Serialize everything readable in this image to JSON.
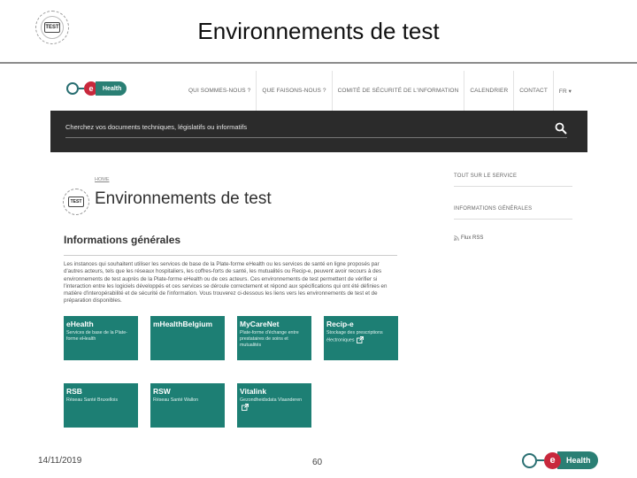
{
  "slide": {
    "title": "Environnements de test",
    "logo_text": "TEST",
    "date": "14/11/2019",
    "page_number": "60",
    "footer_logo": {
      "e": "e",
      "word": "Health"
    }
  },
  "site": {
    "brand": {
      "e": "e",
      "word": "Health"
    },
    "nav": [
      "QUI SOMMES-NOUS ?",
      "QUE FAISONS-NOUS ?",
      "COMITÉ DE SÉCURITÉ DE L'INFORMATION",
      "CALENDRIER",
      "CONTACT",
      "FR ▾"
    ],
    "search": {
      "placeholder": "Cherchez vos documents techniques, législatifs ou informatifs"
    },
    "breadcrumb": "HOME",
    "page_logo_text": "TEST",
    "page_title": "Environnements de test",
    "section_title": "Informations générales",
    "intro": "Les instances qui souhaitent utiliser les services de base de la Plate-forme eHealth ou les services de santé en ligne proposés par d'autres acteurs, tels que les réseaux hospitaliers, les coffres-forts de santé, les mutualités ou Recip-e, peuvent avoir recours à des environnements de test auprès de la Plate-forme eHealth ou de ces acteurs. Ces environnements de test permettent de vérifier si l'interaction entre les logiciels développés et ces services se déroule correctement et répond aux spécifications qui ont été définies en matière d'interopérabilité et de sécurité de l'information. Vous trouverez ci-dessous les liens vers les environnements de test et de préparation disponibles.",
    "tiles": [
      {
        "title": "eHealth",
        "desc": "Services de base de la Plate-forme eHealth",
        "ext": false
      },
      {
        "title": "mHealthBelgium",
        "desc": "",
        "ext": false
      },
      {
        "title": "MyCareNet",
        "desc": "Plate-forme d'échange entre prestataires de soins et mutualités",
        "ext": false
      },
      {
        "title": "Recip-e",
        "desc": "Stockage des prescriptions électroniques",
        "ext": true
      },
      {
        "title": "RSB",
        "desc": "Réseau Santé Bruxellois",
        "ext": false
      },
      {
        "title": "RSW",
        "desc": "Réseau Santé Wallon",
        "ext": false
      },
      {
        "title": "Vitalink",
        "desc": "Gezondheidsdata Vlaanderen",
        "ext": true
      }
    ],
    "sidebar": {
      "service_link": "TOUT SUR LE SERVICE",
      "info_link": "INFORMATIONS GÉNÉRALES",
      "rss": "Flux RSS"
    }
  },
  "colors": {
    "tile": "#1d7f74",
    "search_bar": "#2b2b2b",
    "brand_red": "#c8283c"
  }
}
